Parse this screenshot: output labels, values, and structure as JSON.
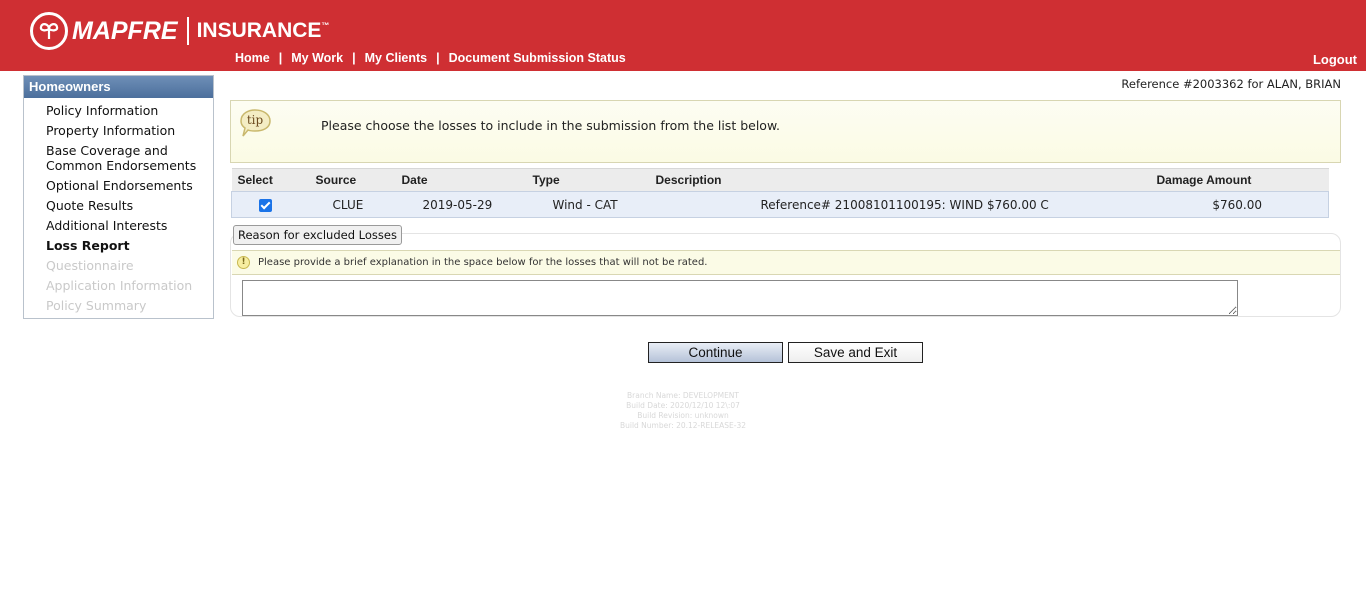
{
  "header": {
    "brand": "MAPFRE",
    "brand2": "INSURANCE",
    "brand2_mark": "™",
    "nav": [
      "Home",
      "My Work",
      "My Clients",
      "Document Submission Status"
    ],
    "nav_sep": "|",
    "logout": "Logout",
    "color": "#cf2f33"
  },
  "sidebar": {
    "title": "Homeowners",
    "items": [
      {
        "label": "Policy Information",
        "state": "normal"
      },
      {
        "label": "Property Information",
        "state": "normal"
      },
      {
        "label": "Base Coverage and Common Endorsements",
        "state": "normal"
      },
      {
        "label": "Optional Endorsements",
        "state": "normal"
      },
      {
        "label": "Quote Results",
        "state": "normal"
      },
      {
        "label": "Additional Interests",
        "state": "normal"
      },
      {
        "label": "Loss Report",
        "state": "active"
      },
      {
        "label": "Questionnaire",
        "state": "disabled"
      },
      {
        "label": "Application Information",
        "state": "disabled"
      },
      {
        "label": "Policy Summary",
        "state": "disabled"
      }
    ]
  },
  "reference": "Reference #2003362 for ALAN, BRIAN",
  "tip": {
    "icon": "tip-bubble-icon",
    "label": "tip",
    "text": "Please choose the losses to include in the submission from the list below."
  },
  "losses": {
    "columns": [
      "Select",
      "Source",
      "Date",
      "Type",
      "Description",
      "Damage Amount"
    ],
    "rows": [
      {
        "selected": true,
        "source": "CLUE",
        "date": "2019-05-29",
        "type": "Wind - CAT",
        "description": "Reference# 21008101100195: WIND $760.00 C",
        "amount": "$760.00"
      }
    ]
  },
  "reason": {
    "legend": "Reason for excluded Losses",
    "info": "Please provide a brief explanation in the space below for the losses that will not be rated.",
    "value": ""
  },
  "buttons": {
    "continue": "Continue",
    "save_exit": "Save and Exit"
  },
  "build": {
    "branch": "Branch Name: DEVELOPMENT",
    "date": "Build Date: 2020/12/10 12\\:07",
    "revision": "Build Revision: unknown",
    "number": "Build Number: 20.12-RELEASE-32"
  }
}
